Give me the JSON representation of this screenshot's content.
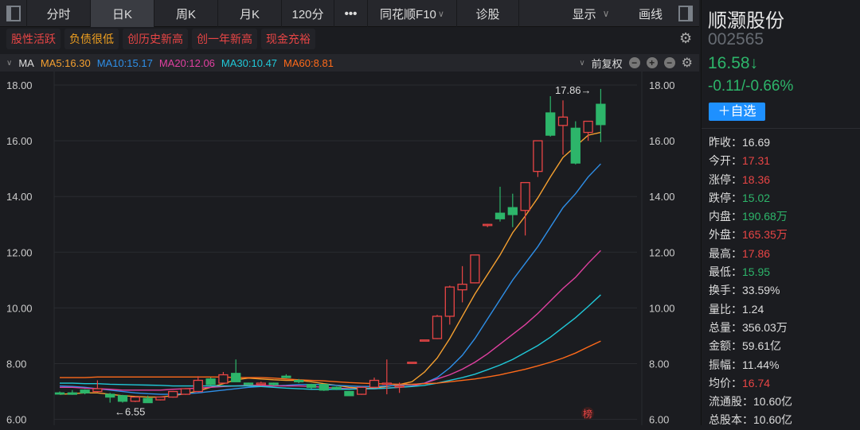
{
  "toolbar": {
    "tabs": [
      "分时",
      "日K",
      "周K",
      "月K",
      "120分"
    ],
    "more": "•••",
    "f10": "同花顺F10",
    "f10_arrow": "∨",
    "diag": "诊股",
    "display": "显示",
    "display_arrow": "∨",
    "draw": "画线"
  },
  "tags": [
    {
      "label": "股性活跃",
      "color": "#e84545"
    },
    {
      "label": "负债很低",
      "color": "#f0a020"
    },
    {
      "label": "创历史新高",
      "color": "#e84545"
    },
    {
      "label": "创一年新高",
      "color": "#e84545"
    },
    {
      "label": "现金充裕",
      "color": "#e84545"
    }
  ],
  "ma_bar": {
    "arrow": "∨",
    "label": "MA",
    "items": [
      {
        "text": "MA5:16.30",
        "color": "#f5a030"
      },
      {
        "text": "MA10:15.17",
        "color": "#2e8fe8"
      },
      {
        "text": "MA20:12.06",
        "color": "#e040a0"
      },
      {
        "text": "MA30:10.47",
        "color": "#20c8d8"
      },
      {
        "text": "MA60:8.81",
        "color": "#ff6a1a"
      }
    ],
    "adjust_arrow": "∨",
    "adjust": "前复权",
    "zoom_out": "−",
    "zoom_in": "+",
    "minus": "−"
  },
  "stock": {
    "name": "顺灏股份",
    "code": "002565",
    "price": "16.58↓",
    "change": "-0.11/-0.66%",
    "add_watch": "＋自选"
  },
  "stats": [
    {
      "label": "昨收：",
      "value": "16.69",
      "cls": "wh"
    },
    {
      "label": "今开：",
      "value": "17.31",
      "cls": "red"
    },
    {
      "label": "涨停：",
      "value": "18.36",
      "cls": "red"
    },
    {
      "label": "跌停：",
      "value": "15.02",
      "cls": "green"
    },
    {
      "label": "内盘：",
      "value": "190.68万",
      "cls": "green"
    },
    {
      "label": "外盘：",
      "value": "165.35万",
      "cls": "red"
    },
    {
      "label": "最高：",
      "value": "17.86",
      "cls": "red"
    },
    {
      "label": "最低：",
      "value": "15.95",
      "cls": "green"
    },
    {
      "label": "换手：",
      "value": "33.59%",
      "cls": "wh"
    },
    {
      "label": "量比：",
      "value": "1.24",
      "cls": "wh"
    },
    {
      "label": "总量：",
      "value": "356.03万",
      "cls": "wh"
    },
    {
      "label": "金额：",
      "value": "59.61亿",
      "cls": "wh"
    },
    {
      "label": "振幅：",
      "value": "11.44%",
      "cls": "wh"
    },
    {
      "label": "均价：",
      "value": "16.74",
      "cls": "red"
    },
    {
      "label": "流通股：",
      "value": "10.60亿",
      "cls": "wh"
    },
    {
      "label": "总股本：",
      "value": "10.60亿",
      "cls": "wh"
    }
  ],
  "chart_data": {
    "type": "candlestick",
    "ylim": [
      6,
      18
    ],
    "yticks": [
      "18.00",
      "16.00",
      "14.00",
      "12.00",
      "10.00",
      "8.00",
      "6.00"
    ],
    "annotations": {
      "high": "17.86→",
      "low": "←6.55",
      "badge": "榜"
    },
    "colors": {
      "up": "#e84545",
      "down": "#2db56a"
    },
    "ohlc": [
      [
        6.95,
        7.0,
        6.9,
        6.92
      ],
      [
        6.95,
        7.05,
        6.88,
        6.9
      ],
      [
        7.05,
        7.08,
        6.9,
        6.95
      ],
      [
        7.0,
        7.4,
        6.98,
        7.1
      ],
      [
        6.9,
        6.95,
        6.6,
        6.8
      ],
      [
        6.85,
        6.88,
        6.6,
        6.65
      ],
      [
        6.65,
        6.82,
        6.62,
        6.8
      ],
      [
        6.75,
        6.85,
        6.6,
        6.6
      ],
      [
        6.7,
        6.82,
        6.68,
        6.8
      ],
      [
        6.8,
        7.02,
        6.78,
        7.0
      ],
      [
        6.9,
        7.12,
        6.88,
        7.1
      ],
      [
        7.0,
        7.55,
        6.98,
        7.4
      ],
      [
        7.45,
        7.5,
        7.2,
        7.25
      ],
      [
        7.3,
        7.7,
        7.28,
        7.6
      ],
      [
        7.65,
        8.15,
        7.6,
        7.35
      ],
      [
        7.3,
        7.32,
        7.22,
        7.25
      ],
      [
        7.25,
        7.35,
        7.2,
        7.3
      ],
      [
        7.3,
        7.32,
        7.2,
        7.25
      ],
      [
        7.55,
        7.62,
        7.48,
        7.5
      ],
      [
        7.4,
        7.45,
        7.3,
        7.35
      ],
      [
        7.25,
        7.28,
        7.1,
        7.15
      ],
      [
        7.25,
        7.28,
        7.02,
        7.05
      ],
      [
        7.15,
        7.18,
        7.05,
        7.1
      ],
      [
        7.0,
        7.02,
        6.85,
        6.85
      ],
      [
        6.9,
        7.18,
        6.88,
        7.15
      ],
      [
        7.15,
        7.5,
        7.12,
        7.4
      ],
      [
        7.3,
        8.15,
        6.9,
        7.3
      ],
      [
        7.2,
        7.32,
        6.95,
        7.2
      ],
      [
        8.05,
        8.05,
        8.05,
        8.05
      ],
      [
        8.85,
        8.85,
        8.85,
        8.85
      ],
      [
        8.9,
        9.75,
        8.88,
        9.7
      ],
      [
        9.7,
        10.8,
        9.4,
        10.75
      ],
      [
        10.65,
        11.5,
        10.2,
        10.85
      ],
      [
        10.9,
        11.9,
        10.88,
        11.9
      ],
      [
        13.0,
        13.02,
        12.9,
        13.0
      ],
      [
        13.4,
        14.35,
        13.1,
        13.2
      ],
      [
        13.6,
        14.1,
        12.9,
        13.35
      ],
      [
        13.5,
        14.5,
        12.6,
        14.5
      ],
      [
        14.9,
        16.0,
        14.7,
        16.0
      ],
      [
        17.0,
        17.6,
        16.15,
        16.2
      ],
      [
        16.55,
        17.45,
        15.5,
        16.85
      ],
      [
        16.45,
        16.7,
        15.15,
        15.2
      ],
      [
        16.3,
        16.7,
        16.0,
        16.7
      ],
      [
        17.31,
        17.86,
        15.95,
        16.58
      ]
    ],
    "ma": [
      {
        "name": "MA5",
        "color": "#f5a030",
        "values": [
          6.9,
          6.92,
          6.95,
          6.95,
          6.9,
          6.85,
          6.82,
          6.8,
          6.8,
          6.85,
          6.92,
          7.02,
          7.15,
          7.28,
          7.42,
          7.48,
          7.45,
          7.42,
          7.4,
          7.4,
          7.35,
          7.28,
          7.22,
          7.15,
          7.12,
          7.12,
          7.18,
          7.25,
          7.35,
          7.7,
          8.2,
          8.9,
          9.7,
          10.5,
          11.2,
          11.9,
          12.7,
          13.3,
          13.95,
          14.7,
          15.4,
          15.8,
          16.2,
          16.3
        ]
      },
      {
        "name": "MA10",
        "color": "#2e8fe8",
        "values": [
          7.2,
          7.18,
          7.15,
          7.1,
          7.05,
          7.0,
          6.95,
          6.92,
          6.9,
          6.9,
          6.92,
          6.95,
          7.0,
          7.05,
          7.1,
          7.15,
          7.18,
          7.2,
          7.22,
          7.25,
          7.25,
          7.25,
          7.22,
          7.2,
          7.18,
          7.18,
          7.2,
          7.22,
          7.25,
          7.3,
          7.5,
          7.85,
          8.3,
          8.9,
          9.6,
          10.3,
          11.0,
          11.6,
          12.2,
          12.9,
          13.6,
          14.1,
          14.7,
          15.17
        ]
      },
      {
        "name": "MA20",
        "color": "#e040a0",
        "values": [
          7.15,
          7.15,
          7.12,
          7.1,
          7.08,
          7.05,
          7.05,
          7.05,
          7.05,
          7.08,
          7.1,
          7.12,
          7.15,
          7.18,
          7.2,
          7.22,
          7.22,
          7.2,
          7.2,
          7.2,
          7.18,
          7.15,
          7.12,
          7.1,
          7.1,
          7.1,
          7.12,
          7.15,
          7.2,
          7.3,
          7.45,
          7.6,
          7.8,
          8.05,
          8.35,
          8.7,
          9.05,
          9.4,
          9.8,
          10.25,
          10.7,
          11.1,
          11.6,
          12.06
        ]
      },
      {
        "name": "MA30",
        "color": "#20c8d8",
        "values": [
          7.3,
          7.3,
          7.28,
          7.28,
          7.26,
          7.25,
          7.24,
          7.23,
          7.22,
          7.2,
          7.2,
          7.2,
          7.2,
          7.2,
          7.2,
          7.2,
          7.18,
          7.15,
          7.12,
          7.1,
          7.08,
          7.08,
          7.08,
          7.08,
          7.1,
          7.1,
          7.12,
          7.15,
          7.18,
          7.22,
          7.3,
          7.4,
          7.5,
          7.62,
          7.78,
          7.95,
          8.15,
          8.4,
          8.65,
          8.95,
          9.3,
          9.65,
          10.05,
          10.47
        ]
      },
      {
        "name": "MA60",
        "color": "#ff6a1a",
        "values": [
          7.5,
          7.5,
          7.5,
          7.52,
          7.52,
          7.52,
          7.52,
          7.52,
          7.52,
          7.52,
          7.52,
          7.52,
          7.52,
          7.52,
          7.5,
          7.5,
          7.5,
          7.48,
          7.45,
          7.42,
          7.4,
          7.38,
          7.35,
          7.32,
          7.3,
          7.28,
          7.27,
          7.26,
          7.26,
          7.28,
          7.3,
          7.35,
          7.4,
          7.45,
          7.52,
          7.6,
          7.7,
          7.8,
          7.92,
          8.05,
          8.2,
          8.38,
          8.6,
          8.81
        ]
      }
    ]
  }
}
